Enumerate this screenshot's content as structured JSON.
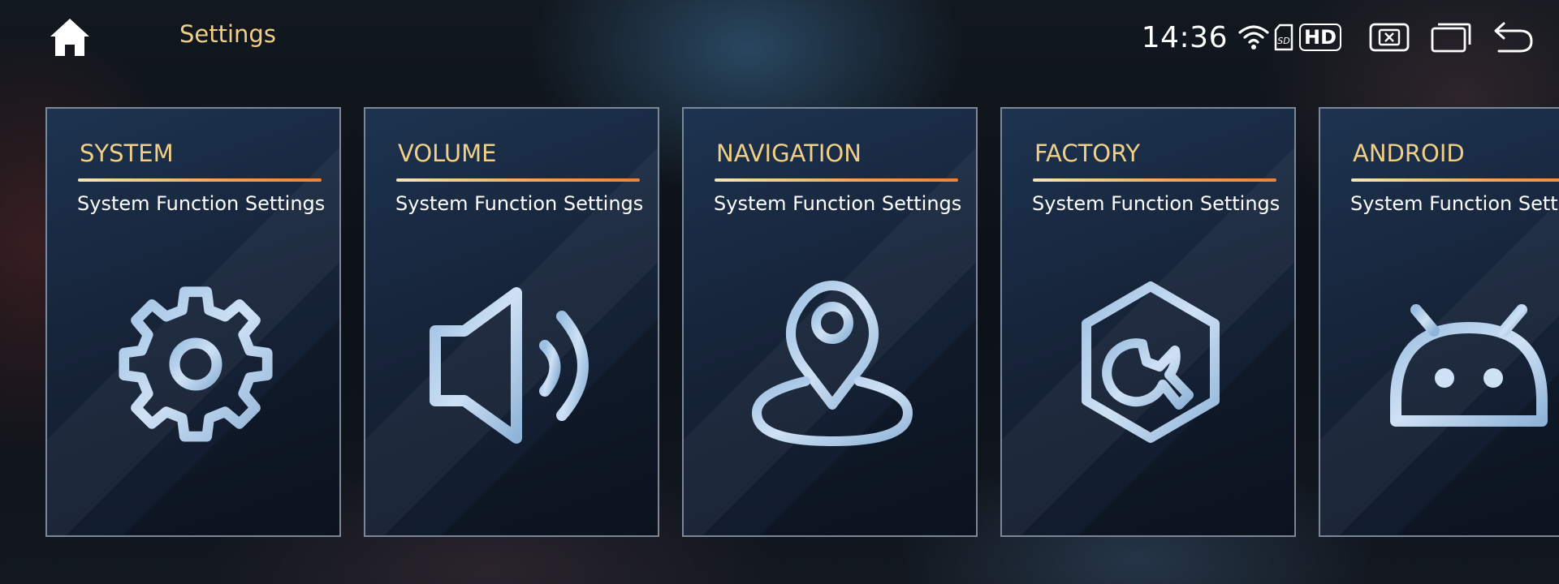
{
  "header": {
    "home_icon": "home-icon",
    "title": "Settings"
  },
  "status_bar": {
    "time": "14:36",
    "wifi_icon": "wifi-icon",
    "sd_icon": "sd-card-icon",
    "hd_label": "HD",
    "close_app_icon": "close-app-icon",
    "recent_apps_icon": "recent-apps-icon",
    "back_icon": "back-icon"
  },
  "cards": [
    {
      "title": "SYSTEM",
      "subtitle": "System Function Settings",
      "icon": "gear-icon"
    },
    {
      "title": "VOLUME",
      "subtitle": "System Function Settings",
      "icon": "speaker-icon"
    },
    {
      "title": "NAVIGATION",
      "subtitle": "System Function Settings",
      "icon": "map-pin-icon"
    },
    {
      "title": "FACTORY",
      "subtitle": "System Function Settings",
      "icon": "wrench-hexagon-icon"
    },
    {
      "title": "ANDROID",
      "subtitle": "System Function Settings",
      "icon": "android-icon"
    }
  ],
  "colors": {
    "accent_title": "#f1cf86",
    "card_border": "#7b8796",
    "icon_light": "#dce9f8",
    "icon_dark": "#7fa7cc"
  }
}
